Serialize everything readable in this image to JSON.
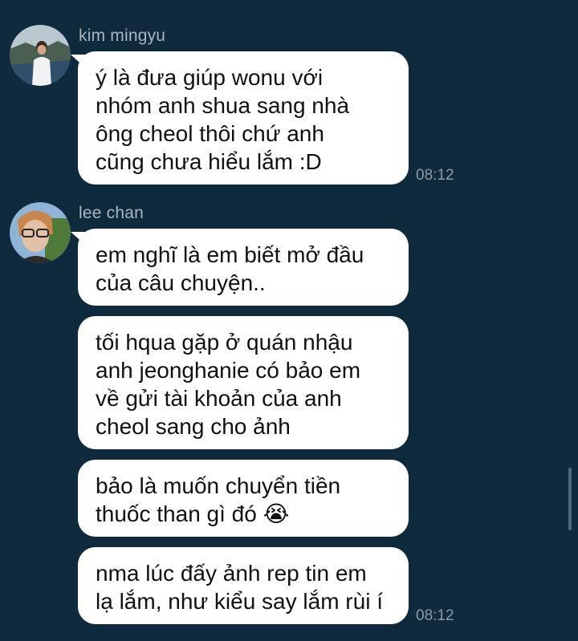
{
  "conversation": {
    "groups": [
      {
        "sender": "kim mingyu",
        "avatar_icon": "avatar-kim-mingyu",
        "messages": [
          "ý là đưa giúp wonu với\nnhóm anh shua sang nhà\nông cheol thôi chứ anh\ncũng chưa hiểu lắm :D"
        ],
        "time": "08:12"
      },
      {
        "sender": "lee chan",
        "avatar_icon": "avatar-lee-chan",
        "messages": [
          "em nghĩ là em biết mở đầu\ncủa câu chuyện..",
          "tối hqua gặp ở quán nhậu\nanh jeonghanie có bảo em\nvề gửi tài khoản của anh\ncheol sang cho ảnh",
          "bảo là muốn chuyển tiền\nthuốc than gì đó 😭",
          "nma lúc đấy ảnh rep tin em\nlạ lắm, như kiểu say lắm rùi í"
        ],
        "time": "08:12"
      }
    ]
  },
  "colors": {
    "background": "#0e2a3c",
    "bubble": "#ffffff",
    "sender_name": "#a9b6bf",
    "timestamp": "#8d9ba5"
  }
}
